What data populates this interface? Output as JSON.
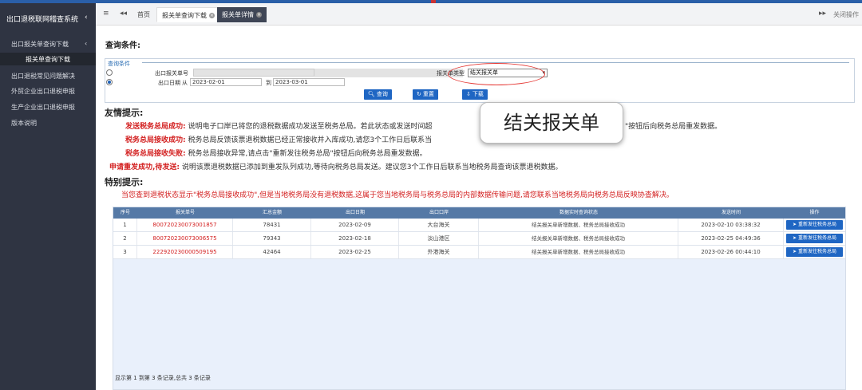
{
  "sidebar": {
    "title": "出口退税联网稽查系统",
    "title_chevron": "‹",
    "items": [
      {
        "label": "出口报关单查询下载",
        "chevron": "‹"
      },
      {
        "label": "报关单查询下载"
      },
      {
        "label": "出口退税常见问题解决"
      },
      {
        "label": "外贸企业出口退税申报"
      },
      {
        "label": "生产企业出口退税申报"
      },
      {
        "label": "版本说明"
      }
    ]
  },
  "tabbar": {
    "menu_icon": "≡",
    "back_icon": "◂◂",
    "tabs": [
      {
        "label": "首页"
      },
      {
        "label": "报关单查询下载"
      },
      {
        "label": "报关单详情"
      }
    ],
    "forward_icon": "▸▸",
    "close_all_label": "关闭操作"
  },
  "query": {
    "heading": "查询条件:",
    "legend": "查询条件",
    "declaration_no_label": "出口报关单号",
    "declaration_type_label": "报关单类型",
    "declaration_type_value": "结关报关单",
    "export_date_label": "出口日期",
    "from_label": "从",
    "from_date": "2023-02-01",
    "to_label": "到",
    "to_date": "2023-03-01",
    "buttons": {
      "search": "查询",
      "reset": "重置",
      "download": "下载"
    }
  },
  "tooltip": {
    "text": "结关报关单"
  },
  "tips": {
    "heading": "友情提示:",
    "lines": [
      {
        "label": "发送税务总局成功:",
        "text": "说明电子口岸已将您的退税数据成功发送至税务总局。若此状态或发送时间超",
        "text2": "\"按钮后向税务总局重发数据。"
      },
      {
        "label": "税务总局接收成功:",
        "text": "税务总局反馈该票退税数据已经正常接收并入库成功,请您3个工作日后联系当"
      },
      {
        "label": "税务总局接收失败:",
        "text": "税务总局接收异常,请点击\"重新发往税务总局\"按钮后向税务总局重发数据。"
      },
      {
        "label": "申请重发成功,待发送:",
        "text": "说明该票退税数据已添加到重发队列成功,等待向税务总局发送。建议您3个工作日后联系当地税务局查询该票退税数据。"
      }
    ]
  },
  "special": {
    "heading": "特别提示:",
    "text": "当您查到退税状态显示\"税务总局接收成功\",但是当地税务局没有退税数据,这属于您当地税务局与税务总局的内部数据传输问题,请您联系当地税务局向税务总局反映协查解决。"
  },
  "table": {
    "columns": [
      "序号",
      "报关单号",
      "汇总金额",
      "出口日期",
      "出口口岸",
      "数据实时查询状态",
      "发送时间",
      "操作"
    ],
    "rows": [
      {
        "no": "1",
        "id": "800720230073001857",
        "amount": "78431",
        "date": "2023-02-09",
        "port": "大台海关",
        "status": "结关报关单新增数据、税务总局接收成功",
        "sent": "2023-02-10 03:38:32",
        "action": "重新发往税务总局"
      },
      {
        "no": "2",
        "id": "800720230073006575",
        "amount": "79343",
        "date": "2023-02-18",
        "port": "淡山港区",
        "status": "结关报关单新增数据、税务总局接收成功",
        "sent": "2023-02-25 04:49:36",
        "action": "重新发往税务总局"
      },
      {
        "no": "3",
        "id": "222920230000509195",
        "amount": "42464",
        "date": "2023-02-25",
        "port": "外港海关",
        "status": "结关报关单新增数据、税务总局接收成功",
        "sent": "2023-02-26 00:44:10",
        "action": "重新发往税务总局"
      }
    ],
    "footer": "显示第 1 到第 3 条记录,总共 3 条记录"
  },
  "colors": {
    "sidebar_bg": "#2f3442",
    "accent_blue": "#1f66c3",
    "header_blue": "#5579a6",
    "alert_red": "#d32020"
  }
}
